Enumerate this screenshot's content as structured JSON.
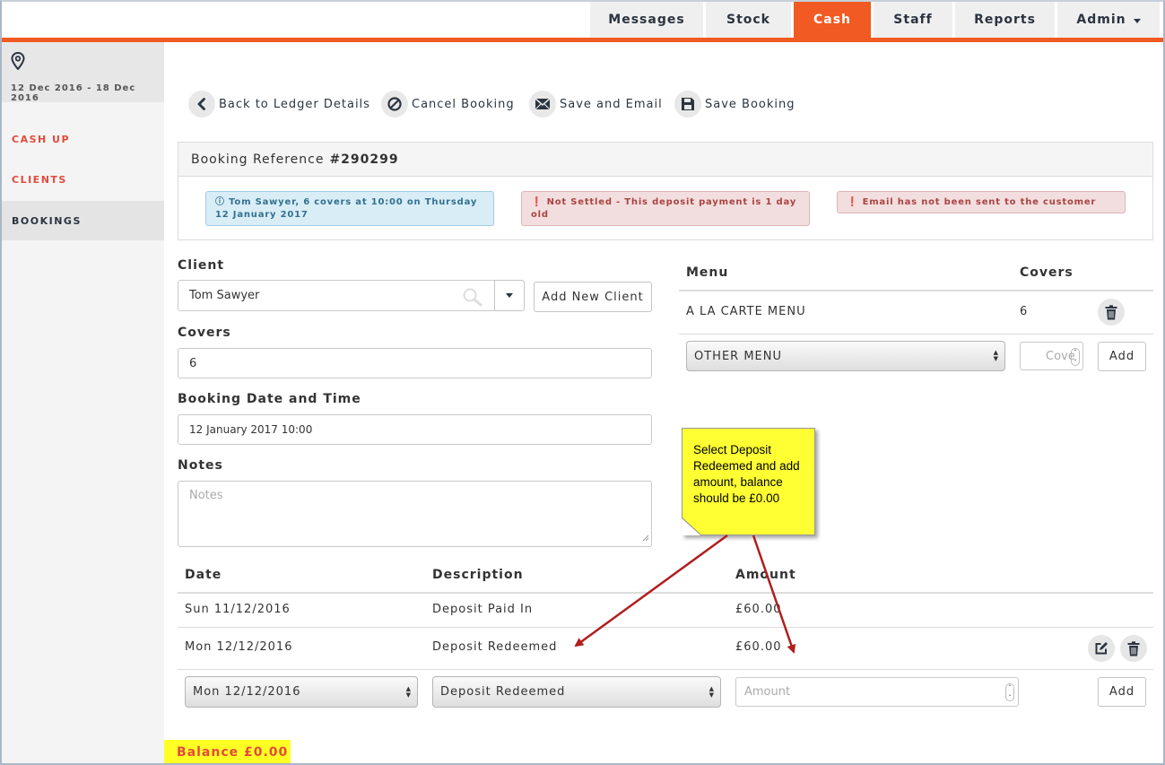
{
  "nav": {
    "tabs": [
      {
        "label": "Messages"
      },
      {
        "label": "Stock"
      },
      {
        "label": "Cash"
      },
      {
        "label": "Staff"
      },
      {
        "label": "Reports"
      },
      {
        "label": "Admin"
      }
    ],
    "active_tab": "Cash",
    "accent_color": "#f15a22"
  },
  "sidebar": {
    "location_icon": "map-pin-icon",
    "date_range": "12 Dec 2016 - 18 Dec 2016",
    "items": [
      {
        "label": "CASH UP"
      },
      {
        "label": "CLIENTS"
      },
      {
        "label": "BOOKINGS"
      }
    ]
  },
  "actions": [
    {
      "label": "Back to Ledger Details",
      "icon": "chevron-left-icon"
    },
    {
      "label": "Cancel Booking",
      "icon": "ban-icon"
    },
    {
      "label": "Save and Email",
      "icon": "envelope-icon"
    },
    {
      "label": "Save Booking",
      "icon": "floppy-disk-icon"
    }
  ],
  "booking": {
    "reference_label": "Booking Reference",
    "reference_number": "#290299",
    "alerts": [
      {
        "type": "info",
        "text": "Tom Sawyer, 6 covers at 10:00 on Thursday 12 January 2017"
      },
      {
        "type": "danger",
        "text": "Not Settled - This deposit payment is 1 day old"
      },
      {
        "type": "danger",
        "text": "Email has not been sent to the customer"
      }
    ]
  },
  "form": {
    "client_label": "Client",
    "client_value": "Tom Sawyer",
    "add_client_label": "Add New Client",
    "covers_label": "Covers",
    "covers_value": "6",
    "datetime_label": "Booking Date and Time",
    "datetime_value": "12 January 2017 10:00",
    "notes_label": "Notes",
    "notes_placeholder": "Notes"
  },
  "menu": {
    "col_menu": "Menu",
    "col_covers": "Covers",
    "rows": [
      {
        "name": "A LA CARTE MENU",
        "covers": "6"
      }
    ],
    "select_value": "OTHER MENU",
    "covers_placeholder": "Cove",
    "add_label": "Add"
  },
  "ledger": {
    "col_date": "Date",
    "col_description": "Description",
    "col_amount": "Amount",
    "rows": [
      {
        "date": "Sun 11/12/2016",
        "description": "Deposit Paid In",
        "amount": "£60.00"
      },
      {
        "date": "Mon 12/12/2016",
        "description": "Deposit Redeemed",
        "amount": "£60.00"
      }
    ],
    "new_date": "Mon 12/12/2016",
    "new_description": "Deposit Redeemed",
    "amount_placeholder": "Amount",
    "add_label": "Add"
  },
  "annotation": {
    "text": "Select Deposit Redeemed and add amount, balance should be £0.00",
    "color": "#ffff33",
    "arrow_color": "#b01e1e"
  },
  "balance": "Balance £0.00"
}
